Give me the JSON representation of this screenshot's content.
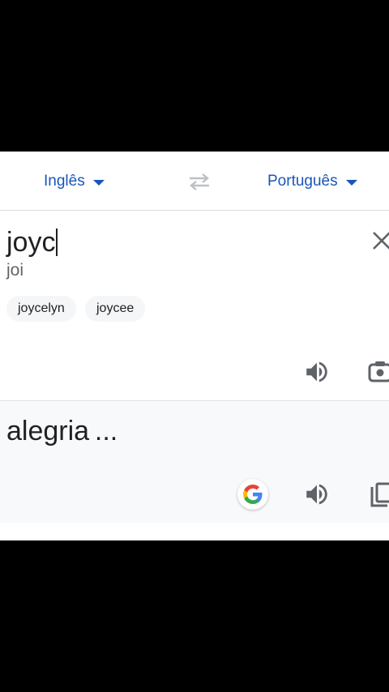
{
  "language_bar": {
    "source_language": "Inglês",
    "target_language": "Português",
    "accent_color": "#1a56b8"
  },
  "input": {
    "text": "joyc",
    "transliteration": "joi",
    "suggestions": [
      "joycelyn",
      "joycee"
    ]
  },
  "output": {
    "text": "alegria ..."
  },
  "icons": {
    "source_dropdown": "caret-down-icon",
    "target_dropdown": "caret-down-icon",
    "swap": "swap-arrows-icon",
    "clear": "close-icon",
    "listen_source": "speaker-icon",
    "camera": "camera-icon",
    "google": "google-g-icon",
    "listen_target": "speaker-icon",
    "copy": "copy-icon"
  }
}
